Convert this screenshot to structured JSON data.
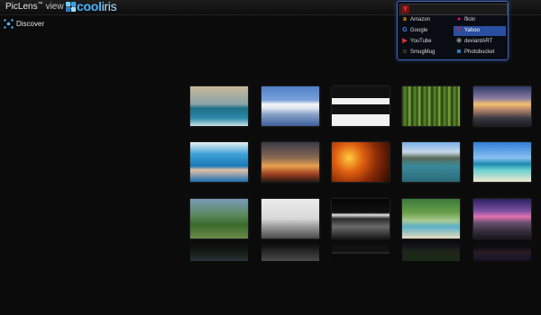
{
  "titlebar": {
    "app_name": "PicLens",
    "trademark": "™",
    "view_for": "view for",
    "logo_text_primary": "cool",
    "logo_text_secondary": "iris"
  },
  "nav": {
    "discover_label": "Discover",
    "discover_icon": "discover-icon"
  },
  "search": {
    "query": "",
    "engine_icon": "yahoo-icon",
    "engines": [
      {
        "label": "Amazon",
        "icon": "amazon-icon",
        "color": "#f0a000",
        "selected": false
      },
      {
        "label": "flickr",
        "icon": "flickr-icon",
        "color": "#ff0084",
        "selected": false
      },
      {
        "label": "Google",
        "icon": "google-icon",
        "color": "#4285f4",
        "selected": false
      },
      {
        "label": "Yahoo",
        "icon": "yahoo-icon",
        "color": "#e02020",
        "selected": true
      },
      {
        "label": "YouTube",
        "icon": "youtube-icon",
        "color": "#e03030",
        "selected": false
      },
      {
        "label": "deviantART",
        "icon": "deviantart-icon",
        "color": "#8fa88f",
        "selected": false
      },
      {
        "label": "SmugMug",
        "icon": "smugmug-icon",
        "color": "#7fbf3f",
        "selected": false
      },
      {
        "label": "Photobucket",
        "icon": "photobucket-icon",
        "color": "#2d8fd8",
        "selected": false
      }
    ]
  },
  "colors": {
    "background": "#0b0b0b",
    "panel_border": "#3d63b8",
    "selected": "#2a4fa0",
    "logo": "#45b6ff"
  },
  "photos": [
    {
      "name": "photo-surfer",
      "bg": "linear-gradient(180deg,#c9b89a 0%,#8aa3a8 45%,#1e6f86 55%,#2a8aa8 80%,#c8e0e8 100%)"
    },
    {
      "name": "photo-snow-mountain-lake",
      "bg": "linear-gradient(180deg,#4f7fc8 0%,#7aa2da 35%,#f4f4f6 45%,#dfe6f0 55%,#8aa4c8 70%,#3d5f9c 100%)"
    },
    {
      "name": "photo-black-white-abstract",
      "bg": "linear-gradient(180deg,#111 0%,#111 30%,#f2f2f2 30%,#f2f2f2 45%,#111 45%,#111 70%,#f2f2f2 70%)"
    },
    {
      "name": "photo-bamboo-forest",
      "bg": "repeating-linear-gradient(90deg,#1f3d12 0px,#5d8a28 3px,#2a4a15 6px,#8db040 8px,#1f3d12 11px)"
    },
    {
      "name": "photo-sunset-rocky-coast",
      "bg": "linear-gradient(180deg,#2d3a6a 0%,#8a7aa0 30%,#f2c070 45%,#b08068 60%,#3a3a42 80%,#1b1b20 100%)"
    },
    {
      "name": "photo-swimmer",
      "bg": "linear-gradient(180deg,#e6f0f6 0%,#3ea2d6 30%,#1a78b8 60%,#e0c0a8 70%,#1c6fb0 100%)"
    },
    {
      "name": "photo-arc-de-triomphe",
      "bg": "linear-gradient(180deg,#3a3a48 0%,#8a6a52 40%,#e8a050 60%,#a04020 80%,#2a1a12 100%)"
    },
    {
      "name": "photo-autumn-leaves",
      "bg": "radial-gradient(circle at 30% 40%,#ffcc40 0%,#e06010 30%,#8a2a08 60%,#2a0a02 100%)"
    },
    {
      "name": "photo-mountain-lake",
      "bg": "linear-gradient(180deg,#7ab0e8 0%,#c8d8e8 25%,#5a6a58 40%,#3a8a9a 60%,#2a6a78 100%)"
    },
    {
      "name": "photo-tropical-beach",
      "bg": "linear-gradient(180deg,#2f7fd8 0%,#8ac0f0 40%,#1a8ab0 55%,#6ad0d0 70%,#f0e8d0 100%)"
    },
    {
      "name": "photo-green-valley",
      "bg": "linear-gradient(180deg,#7a9ab8 0%,#5a8a60 40%,#3a6a2a 65%,#6a8a4a 100%)"
    },
    {
      "name": "photo-gallery-interior",
      "bg": "linear-gradient(180deg,#ececec 0%,#d8d8d8 50%,#9a9a9a 70%,#4a4a4a 100%)"
    },
    {
      "name": "photo-dark-interior",
      "bg": "linear-gradient(180deg,#050505 0%,#111 35%,#e8e8e8 40%,#2a2a2a 50%,#6a6a6a 70%,#1a1a1a 100%)"
    },
    {
      "name": "photo-waterfall-beach",
      "bg": "linear-gradient(180deg,#3a7a3a 0%,#6aa04a 35%,#a8c890 55%,#5ab0c8 70%,#e8dcc0 100%)"
    },
    {
      "name": "photo-purple-sunset",
      "bg": "linear-gradient(180deg,#2a2060 0%,#7a50a0 30%,#e070b0 45%,#6a5070 60%,#3a3040 80%,#1a1520 100%)"
    }
  ]
}
